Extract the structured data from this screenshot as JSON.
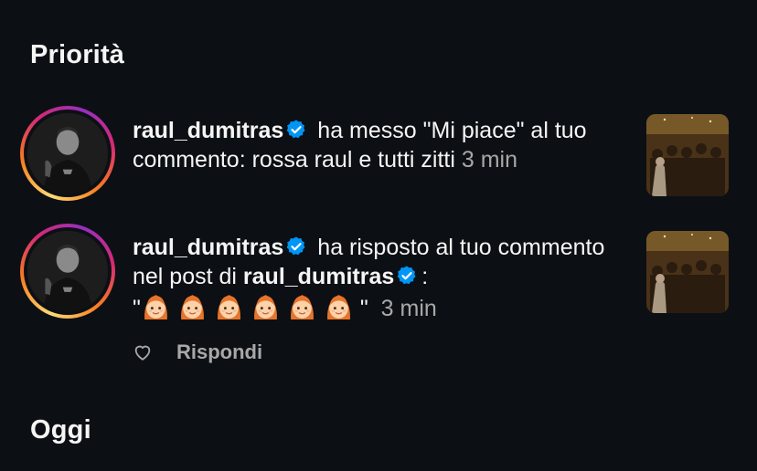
{
  "sections": {
    "priority_title": "Priorità",
    "today_title": "Oggi"
  },
  "notifications": [
    {
      "username": "raul_dumitras",
      "action_text": "ha messo \"Mi piace\" al tuo commento: rossa raul e tutti zitti",
      "time": "3 min"
    },
    {
      "username": "raul_dumitras",
      "action_text": "ha risposto al tuo commento nel post di",
      "post_owner": "raul_dumitras",
      "colon": ":",
      "quote_open": "\"",
      "quote_close": "\"",
      "emoji_count": 6,
      "time": "3 min",
      "reply_label": "Rispondi"
    }
  ],
  "icons": {
    "verified": "verified-badge-icon",
    "heart": "heart-outline-icon",
    "emoji": "woman-red-hair-emoji"
  },
  "colors": {
    "background": "#0c1014",
    "text_primary": "#f5f5f5",
    "text_secondary": "#a8a8a8",
    "verified_blue": "#0095f6"
  }
}
